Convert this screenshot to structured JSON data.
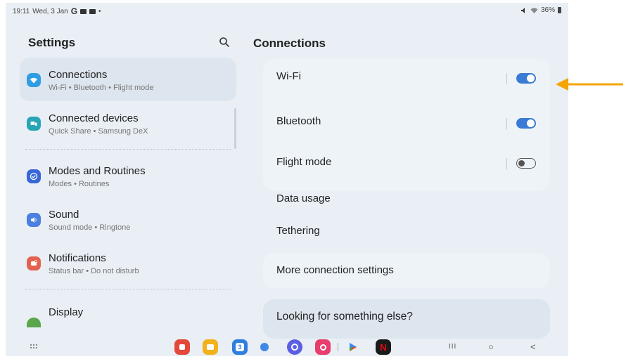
{
  "status": {
    "time": "19:11",
    "date": "Wed, 3 Jan",
    "g_glyph": "G",
    "dot": "•",
    "battery": "36%"
  },
  "left": {
    "title": "Settings",
    "items": [
      {
        "label": "Connections",
        "sub": "Wi-Fi • Bluetooth • Flight mode",
        "color": "#2f9de4"
      },
      {
        "label": "Connected devices",
        "sub": "Quick Share • Samsung DeX",
        "color": "#27a4b5"
      },
      {
        "label": "Modes and Routines",
        "sub": "Modes • Routines",
        "color": "#3967d8"
      },
      {
        "label": "Sound",
        "sub": "Sound mode • Ringtone",
        "color": "#4b7fe0"
      },
      {
        "label": "Notifications",
        "sub": "Status bar • Do not disturb",
        "color": "#e2624f"
      },
      {
        "label": "Display",
        "sub": "",
        "color": "#5aa64a"
      }
    ]
  },
  "right": {
    "title": "Connections",
    "wifi": {
      "label": "Wi-Fi",
      "on": true
    },
    "bluetooth": {
      "label": "Bluetooth",
      "on": true
    },
    "flight": {
      "label": "Flight mode",
      "on": false
    },
    "data_usage": "Data usage",
    "tethering": "Tethering",
    "more": "More connection settings",
    "looking": "Looking for something else?"
  },
  "dock": {
    "apps": [
      {
        "name": "app-icon-red",
        "color": "#e4483a"
      },
      {
        "name": "app-icon-yellow",
        "color": "#f2b21c"
      },
      {
        "name": "calendar-icon",
        "color": "#2d7ee0",
        "text": "3"
      },
      {
        "name": "messages-icon",
        "color": "#3f88e6"
      },
      {
        "name": "internet-icon",
        "color": "#5b5ee3"
      },
      {
        "name": "camera-icon",
        "color": "#e83e6c"
      },
      {
        "name": "play-store-icon",
        "color": "#34a853"
      },
      {
        "name": "netflix-icon",
        "color": "#1a1a1a"
      }
    ],
    "recents": "III",
    "home": "○",
    "back": "<"
  },
  "colors": {
    "accent": "#3a7bd5",
    "arrow": "#f5a500"
  }
}
